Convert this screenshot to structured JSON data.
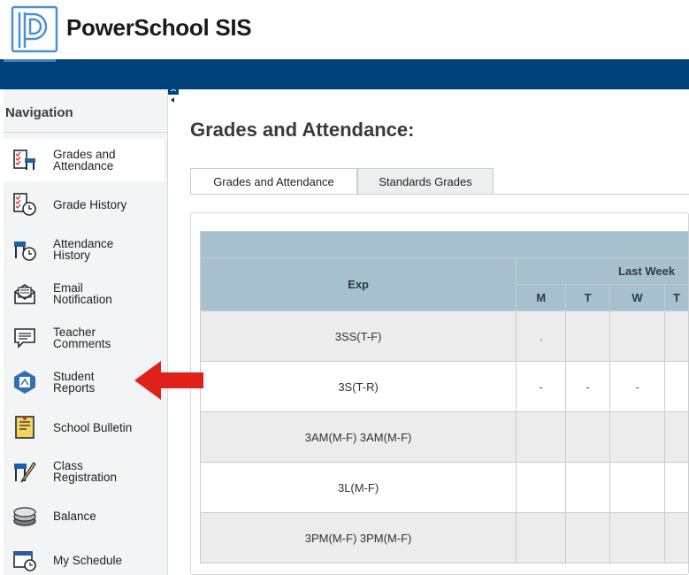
{
  "app": {
    "title": "PowerSchool SIS",
    "logo_icon": "powerschool-logo-icon",
    "header_color": "#00427c"
  },
  "sidebar": {
    "heading": "Navigation",
    "items": [
      {
        "label": "Grades and Attendance",
        "line1": "Grades and",
        "line2": "Attendance",
        "icon": "grades-attendance-icon",
        "active": true
      },
      {
        "label": "Grade History",
        "line1": "Grade History",
        "line2": "",
        "icon": "grade-history-icon"
      },
      {
        "label": "Attendance History",
        "line1": "Attendance",
        "line2": "History",
        "icon": "attendance-history-icon"
      },
      {
        "label": "Email Notification",
        "line1": "Email",
        "line2": "Notification",
        "icon": "email-icon"
      },
      {
        "label": "Teacher Comments",
        "line1": "Teacher",
        "line2": "Comments",
        "icon": "comments-icon"
      },
      {
        "label": "Student Reports",
        "line1": "Student",
        "line2": "Reports",
        "icon": "student-reports-icon"
      },
      {
        "label": "School Bulletin",
        "line1": "School Bulletin",
        "line2": "",
        "icon": "bulletin-icon"
      },
      {
        "label": "Class Registration",
        "line1": "Class",
        "line2": "Registration",
        "icon": "class-registration-icon"
      },
      {
        "label": "Balance",
        "line1": "Balance",
        "line2": "",
        "icon": "balance-icon"
      },
      {
        "label": "My Schedule",
        "line1": "My Schedule",
        "line2": "",
        "icon": "schedule-icon"
      }
    ]
  },
  "main": {
    "title": "Grades and Attendance:",
    "tabs": [
      {
        "label": "Grades and Attendance",
        "active": true
      },
      {
        "label": "Standards Grades",
        "active": false
      }
    ],
    "table": {
      "col_exp": "Exp",
      "group_label": "Last Week",
      "days": [
        "M",
        "T",
        "W",
        "T"
      ],
      "rows": [
        {
          "exp": "3SS(T-F)",
          "cells": [
            ".",
            "",
            "",
            ""
          ]
        },
        {
          "exp": "3S(T-R)",
          "cells": [
            "-",
            "-",
            "-",
            ""
          ]
        },
        {
          "exp": "3AM(M-F) 3AM(M-F)",
          "cells": [
            "",
            "",
            "",
            ""
          ]
        },
        {
          "exp": "3L(M-F)",
          "cells": [
            "",
            "",
            "",
            ""
          ]
        },
        {
          "exp": "3PM(M-F) 3PM(M-F)",
          "cells": [
            "",
            "",
            "",
            ""
          ]
        }
      ]
    }
  },
  "colors": {
    "table_header": "#a6c0ce",
    "arrow": "#e0201b",
    "row_alt": "#ececec"
  }
}
